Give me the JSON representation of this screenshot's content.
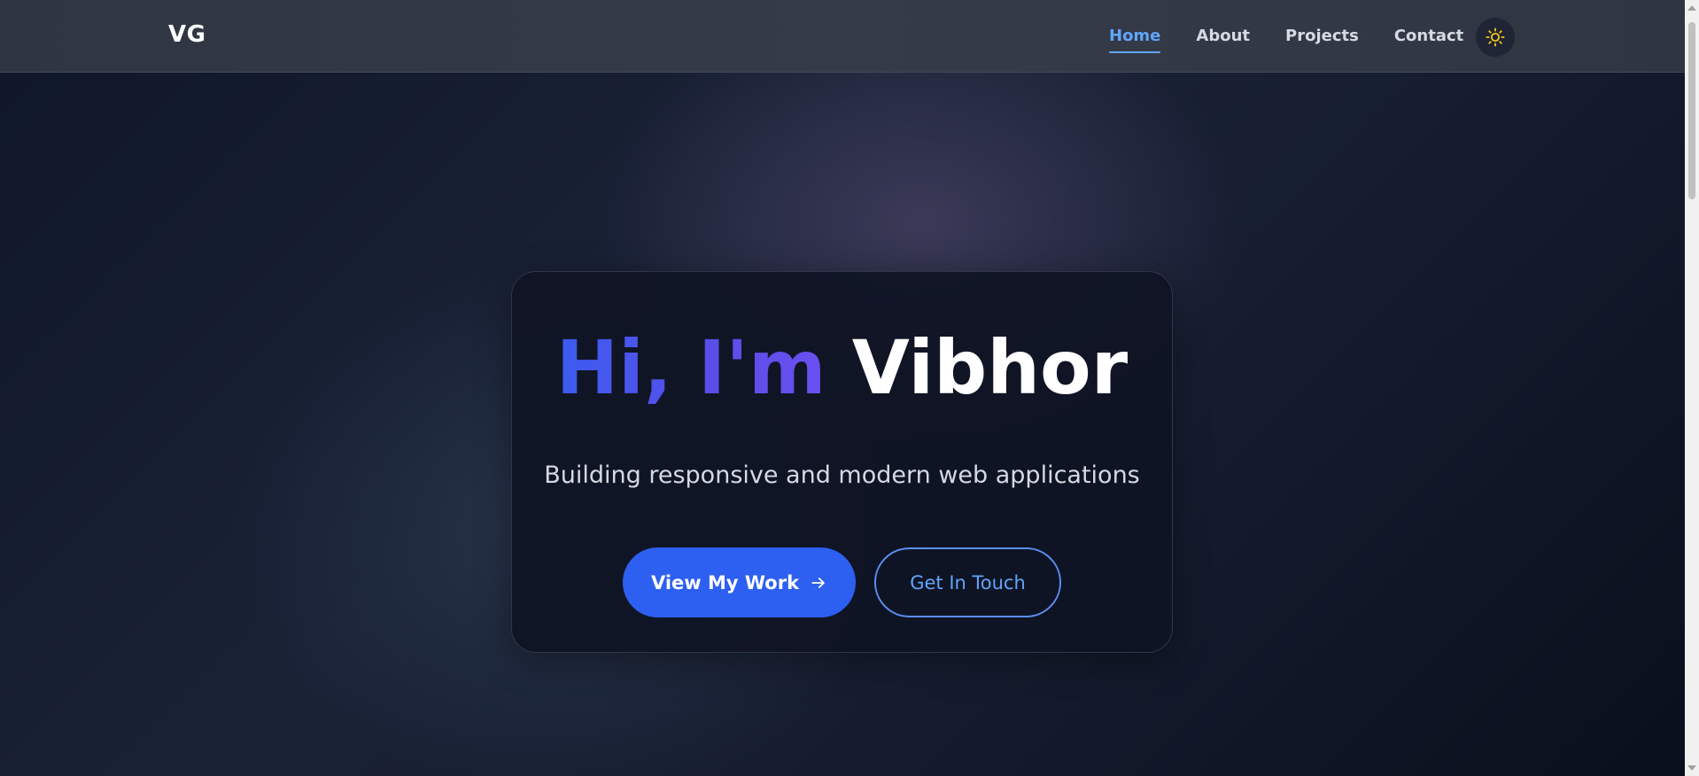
{
  "nav": {
    "logo": "VG",
    "links": [
      {
        "label": "Home",
        "active": true
      },
      {
        "label": "About",
        "active": false
      },
      {
        "label": "Projects",
        "active": false
      },
      {
        "label": "Contact",
        "active": false
      }
    ],
    "theme_toggle_icon": "sun-icon"
  },
  "hero": {
    "greeting": "Hi, I'm",
    "name": "Vibhor",
    "subtitle": "Building responsive and modern web applications",
    "primary_button": {
      "label": "View My Work",
      "icon": "arrow-right-icon"
    },
    "secondary_button": {
      "label": "Get In Touch"
    }
  },
  "colors": {
    "accent": "#60a5fa",
    "primary_button": "#2d5ff0",
    "greeting_gradient_start": "#3b5bf0",
    "greeting_gradient_end": "#6a4ff0",
    "sun_icon": "#f5c518",
    "navbar": "#353b48"
  }
}
